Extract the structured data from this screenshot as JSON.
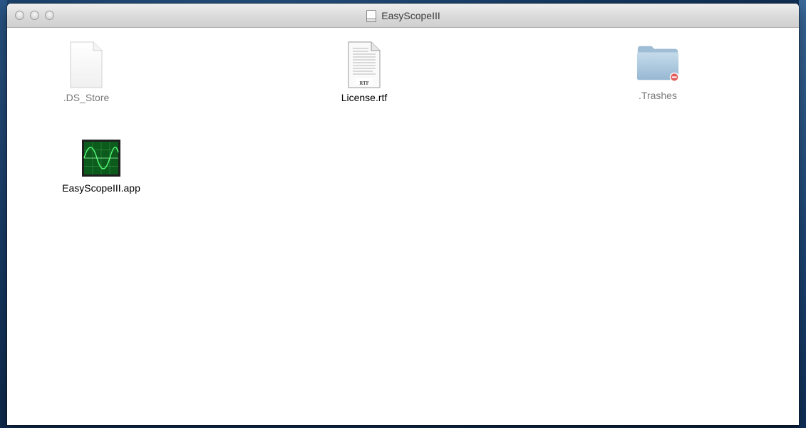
{
  "window": {
    "title": "EasyScopeIII"
  },
  "files": [
    {
      "name": ".DS_Store",
      "icon": "blank-document-icon",
      "hidden": true
    },
    {
      "name": "License.rtf",
      "icon": "rtf-document-icon",
      "badge": "RTF",
      "hidden": false
    },
    {
      "name": ".Trashes",
      "icon": "folder-restricted-icon",
      "hidden": true
    },
    {
      "name": "EasyScopeIII.app",
      "icon": "oscilloscope-app-icon",
      "hidden": false
    }
  ],
  "colors": {
    "folder": "#a9c6dd",
    "restricted_badge": "#e35d5d",
    "scope_screen": "#0c5a1c",
    "scope_trace": "#56ff7a"
  }
}
